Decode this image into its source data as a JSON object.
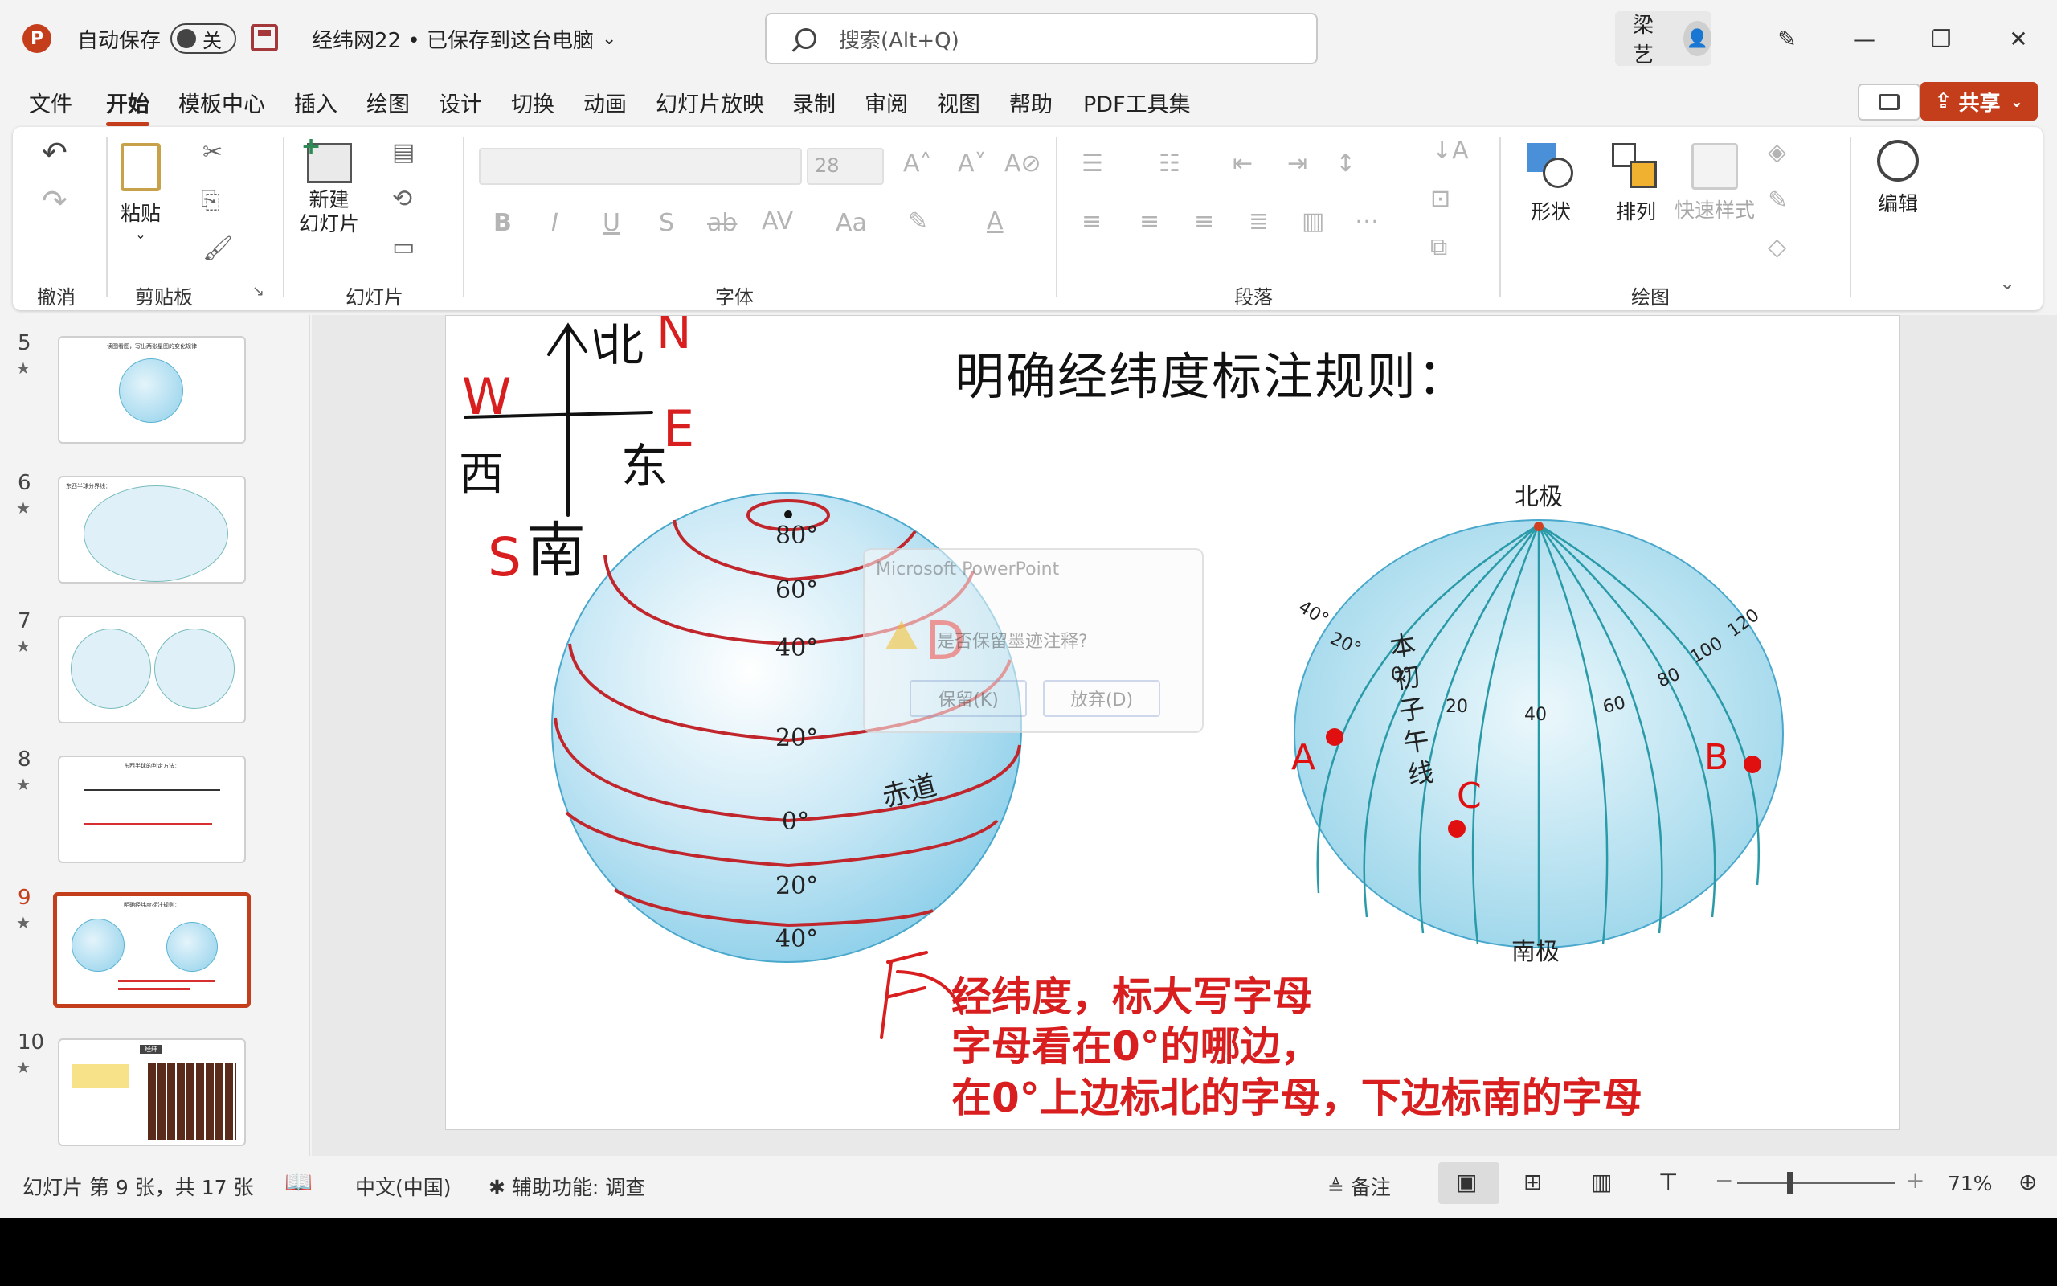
{
  "titlebar": {
    "logo": "P",
    "autosave_label": "自动保存",
    "autosave_state": "关",
    "doc_title": "经纬网22 • 已保存到这台电脑",
    "search_placeholder": "搜索(Alt+Q)",
    "user_name": "梁 艺",
    "buttons": {
      "minimize": "—",
      "restore": "❐",
      "close": "✕"
    }
  },
  "tabs": [
    "文件",
    "开始",
    "模板中心",
    "插入",
    "绘图",
    "设计",
    "切换",
    "动画",
    "幻灯片放映",
    "录制",
    "审阅",
    "视图",
    "帮助",
    "PDF工具集"
  ],
  "share_label": "共享",
  "ribbon": {
    "groups": {
      "undo": "撤消",
      "clipboard": "剪贴板",
      "slides": "幻灯片",
      "font": "字体",
      "paragraph": "段落",
      "drawing": "绘图"
    },
    "paste_label": "粘贴",
    "new_slide_label": "新建\n幻灯片",
    "font_size": "28",
    "shape_label": "形状",
    "arrange_label": "排列",
    "quick_style_label": "快速样式",
    "edit_label": "编辑"
  },
  "thumbnails": [
    {
      "num": "5",
      "title": "读图看图，写出两张星图的变化规律"
    },
    {
      "num": "6",
      "title": "东西半球分界线："
    },
    {
      "num": "7",
      "title": ""
    },
    {
      "num": "8",
      "title": "东西半球的判定方法："
    },
    {
      "num": "9",
      "title": "明确经纬度标注规则："
    },
    {
      "num": "10",
      "title": "经纬"
    }
  ],
  "slide": {
    "title": "明确经纬度标注规则：",
    "ink_labels": [
      "北",
      "N",
      "W",
      "E",
      "西",
      "东",
      "S",
      "南",
      "D",
      "F"
    ],
    "left_globe": {
      "lat_labels": [
        "80°",
        "60°",
        "40°",
        "20°",
        "0°",
        "20°",
        "40°"
      ],
      "equator_label": "赤道"
    },
    "right_globe": {
      "north_pole": "北极",
      "south_pole": "南极",
      "prime_meridian": "本初子午线",
      "lon_labels": [
        "40°",
        "20°",
        "0°",
        "20",
        "40",
        "60",
        "80",
        "100",
        "120"
      ],
      "points": [
        "A",
        "B",
        "C"
      ]
    },
    "red_lines": [
      "经纬度，标大写字母",
      "字母看在0°的哪边，",
      "在0°上边标北的字母，下边标南的字母"
    ]
  },
  "dialog": {
    "title": "Microsoft PowerPoint",
    "message": "是否保留墨迹注释?",
    "keep": "保留(K)",
    "discard": "放弃(D)"
  },
  "statusbar": {
    "slide_info": "幻灯片 第 9 张，共 17 张",
    "language": "中文(中国)",
    "accessibility": "辅助功能: 调查",
    "notes": "备注",
    "zoom": "71%"
  },
  "colors": {
    "accent": "#c43e1c",
    "ink": "#d81e1e",
    "globe": "#8fd0ea"
  }
}
